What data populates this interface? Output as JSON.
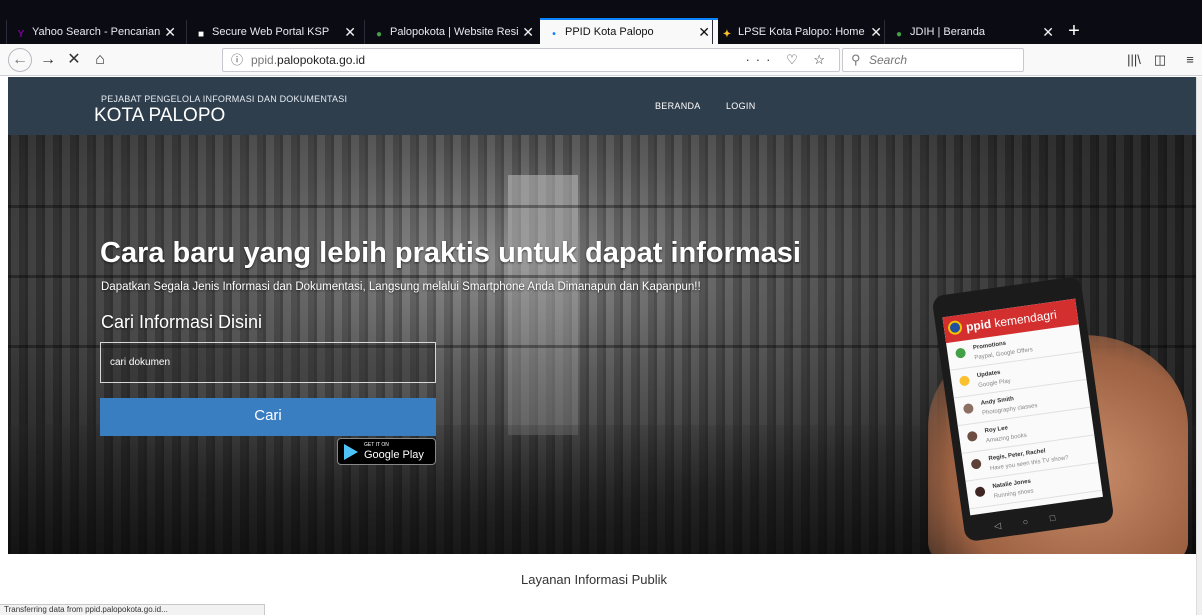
{
  "browser": {
    "tabs": [
      {
        "label": "Yahoo Search - Pencarian",
        "icon": "yahoo-icon",
        "color": "#7b0099",
        "glyph": "Y"
      },
      {
        "label": "Secure Web Portal KSP",
        "icon": "page-icon",
        "color": "#ffffff",
        "glyph": "■"
      },
      {
        "label": "Palopokota | Website Resi",
        "icon": "palopo-icon",
        "color": "#43a047",
        "glyph": "●"
      },
      {
        "label": "PPID Kota Palopo",
        "icon": "loading-icon",
        "color": "#0a84ff",
        "glyph": "•",
        "active": true
      },
      {
        "label": "LPSE Kota Palopo: Home",
        "icon": "lpse-icon",
        "color": "#fbc02d",
        "glyph": "✦"
      },
      {
        "label": "JDIH | Beranda",
        "icon": "jdih-icon",
        "color": "#43a047",
        "glyph": "●"
      }
    ],
    "new_tab": "+",
    "close_glyph": "✕",
    "url": {
      "prefix": "ppid.",
      "domain": "palopokota.go.id"
    },
    "url_actions": "··· ♡ ☆",
    "search_placeholder": "Search",
    "nav": {
      "back": "←",
      "forward": "→",
      "stop": "✕",
      "home": "⌂"
    },
    "toolbar_icons": {
      "library": "|||\\",
      "sidebar": "◫",
      "menu": "≡"
    }
  },
  "site": {
    "header_sub": "PEJABAT PENGELOLA INFORMASI DAN DOKUMENTASI",
    "header_main": "KOTA PALOPO",
    "menu": [
      "BERANDA",
      "LOGIN"
    ]
  },
  "hero": {
    "headline": "Cara baru yang lebih praktis untuk dapat informasi",
    "subline": "Dapatkan Segala Jenis Informasi dan Dokumentasi, Langsung melalui Smartphone Anda Dimanapun dan Kapanpun!!",
    "search_title": "Cari Informasi Disini",
    "search_placeholder": "cari dokumen",
    "search_button": "Cari",
    "google_play_small": "GET IT ON",
    "google_play_big": "Google Play"
  },
  "phone": {
    "brand_bold": "ppid",
    "brand_rest": " kemendagri",
    "rows": [
      {
        "title": "Promotions",
        "sub": "Paypal, Google Offers",
        "color": "#43a047"
      },
      {
        "title": "Updates",
        "sub": "Google Play",
        "color": "#fbc02d"
      },
      {
        "title": "Andy Smith",
        "sub": "Photography classes",
        "color": "#8d6e63"
      },
      {
        "title": "Roy Lee",
        "sub": "Amazing books",
        "color": "#6d4c41"
      },
      {
        "title": "Regis, Peter, Rachel",
        "sub": "Have you seen this TV show?",
        "color": "#5d4037"
      },
      {
        "title": "Natalie Jones",
        "sub": "Running shoes",
        "color": "#3e2723"
      }
    ]
  },
  "section_title": "Layanan Informasi Publik",
  "status_text": "Transferring data from ppid.palopokota.go.id..."
}
